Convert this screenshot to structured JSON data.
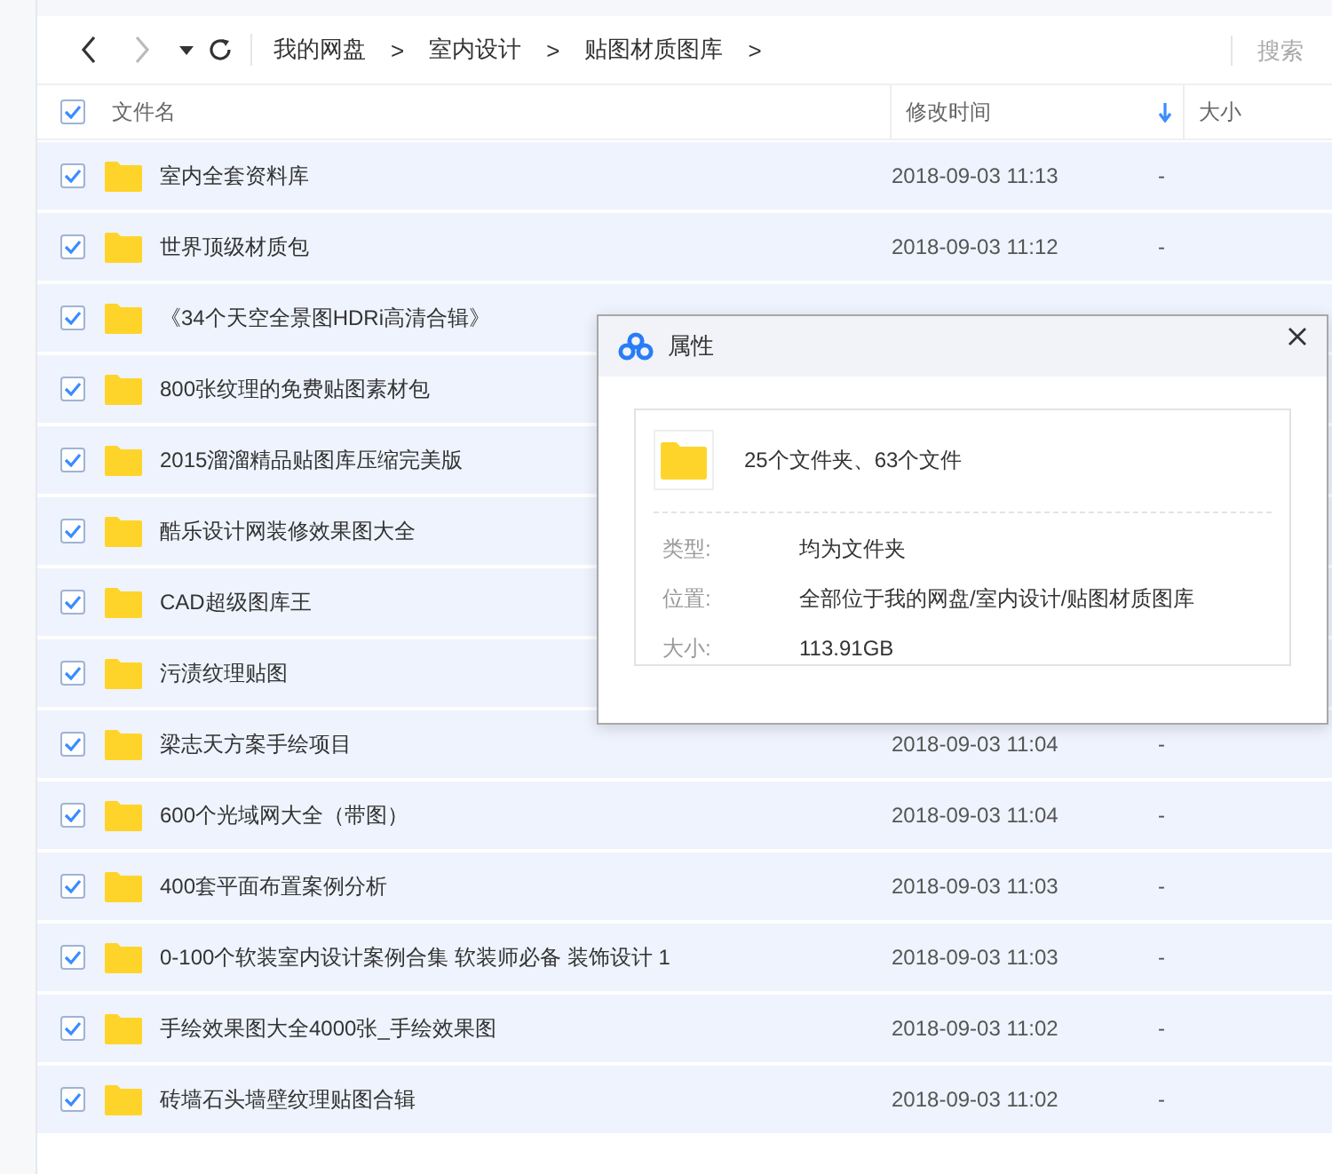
{
  "toolbar": {
    "breadcrumb": [
      "我的网盘",
      "室内设计",
      "贴图材质图库"
    ],
    "separator": ">",
    "search": {
      "placeholder": "搜索"
    }
  },
  "table": {
    "all_checked": true,
    "columns": [
      {
        "label": "文件名",
        "sorted": false
      },
      {
        "label": "修改时间",
        "sorted": true
      },
      {
        "label": "大小",
        "sorted": false
      }
    ],
    "rows": [
      {
        "name": "室内全套资料库",
        "date": "2018-09-03 11:13",
        "size": "-",
        "checked": true
      },
      {
        "name": "世界顶级材质包",
        "date": "2018-09-03 11:12",
        "size": "-",
        "checked": true
      },
      {
        "name": "《34个天空全景图HDRi高清合辑》",
        "checked": true
      },
      {
        "name": "800张纹理的免费贴图素材包",
        "checked": true
      },
      {
        "name": "2015溜溜精品贴图库压缩完美版",
        "checked": true
      },
      {
        "name": "酷乐设计网装修效果图大全",
        "checked": true
      },
      {
        "name": "CAD超级图库王",
        "checked": true
      },
      {
        "name": "污渍纹理贴图",
        "checked": true
      },
      {
        "name": "梁志天方案手绘项目",
        "date": "2018-09-03 11:04",
        "size": "-",
        "checked": true
      },
      {
        "name": "600个光域网大全（带图）",
        "date": "2018-09-03 11:04",
        "size": "-",
        "checked": true
      },
      {
        "name": "400套平面布置案例分析",
        "date": "2018-09-03 11:03",
        "size": "-",
        "checked": true
      },
      {
        "name": "0-100个软装室内设计案例合集 软装师必备 装饰设计 1",
        "date": "2018-09-03 11:03",
        "size": "-",
        "checked": true
      },
      {
        "name": "手绘效果图大全4000张_手绘效果图",
        "date": "2018-09-03 11:02",
        "size": "-",
        "checked": true
      },
      {
        "name": "砖墙石头墙壁纹理贴图合辑",
        "date": "2018-09-03 11:02",
        "size": "-",
        "checked": true
      }
    ]
  },
  "dialog": {
    "title": "属性",
    "summary": "25个文件夹、63个文件",
    "fields": [
      {
        "label": "类型:",
        "value": "均为文件夹"
      },
      {
        "label": "位置:",
        "value": "全部位于我的网盘/室内设计/贴图材质图库"
      },
      {
        "label": "大小:",
        "value": "113.91GB"
      }
    ]
  }
}
